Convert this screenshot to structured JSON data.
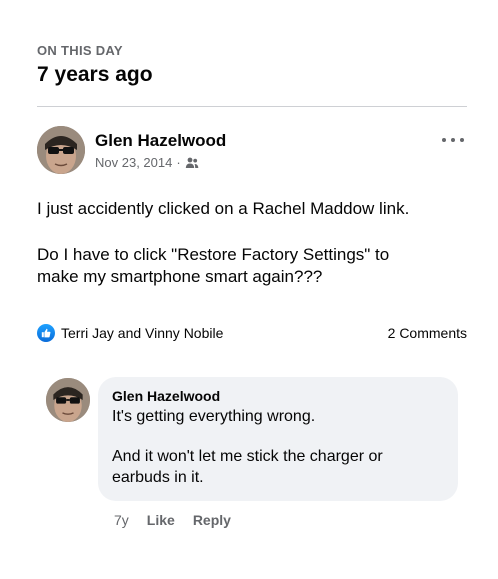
{
  "section": {
    "kicker": "ON THIS DAY",
    "title": "7 years ago"
  },
  "post": {
    "author": "Glen Hazelwood",
    "date": "Nov 23, 2014",
    "meta_separator": "·",
    "audience_icon": "friends-icon",
    "more_icon": "more-options-icon",
    "paragraph_1": "I just accidently clicked on a Rachel Maddow link.",
    "paragraph_2_line_1": "Do I have to click \"Restore Factory Settings\" to",
    "paragraph_2_line_2": "make my smartphone smart again???"
  },
  "reactions": {
    "icon": "like-reaction-icon",
    "reactors": "Terri Jay and Vinny Nobile",
    "comments_count": "2 Comments"
  },
  "comment": {
    "author": "Glen Hazelwood",
    "line_1": "It's getting everything wrong.",
    "line_2": "And it won't let me stick the charger or",
    "line_3": "earbuds in it.",
    "age": "7y",
    "like_label": "Like",
    "reply_label": "Reply"
  },
  "colors": {
    "primary_text": "#050505",
    "secondary_text": "#65676b",
    "comment_bg": "#f0f2f5",
    "like_blue": "#1877f2",
    "divider": "#ced0d4"
  }
}
